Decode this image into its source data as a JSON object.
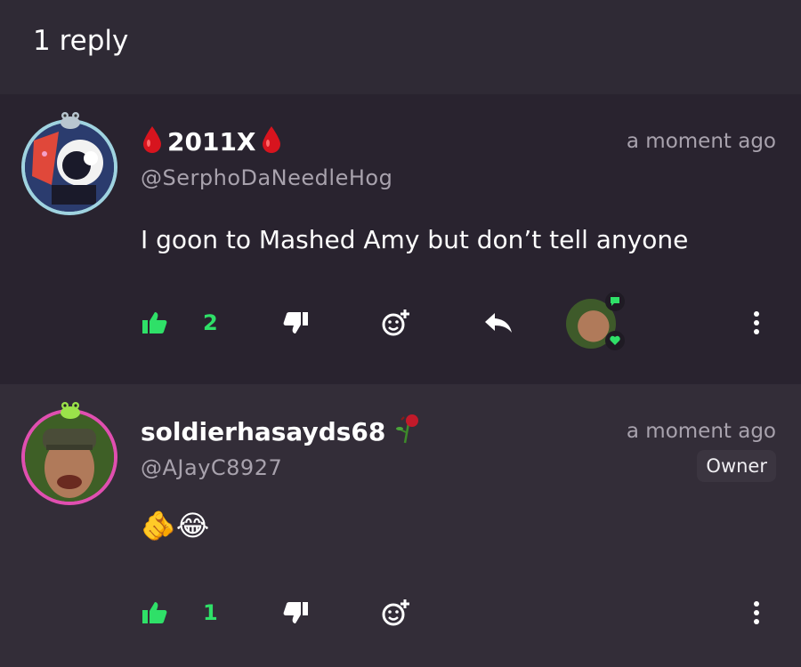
{
  "header": {
    "title": "1 reply"
  },
  "comments": [
    {
      "username": "2011X",
      "handle": "@SerphoDaNeedleHog",
      "time": "a moment ago",
      "body": "I goon to Mashed Amy but don’t tell anyone",
      "likes": "2",
      "decor_icon": "blood-drop-icon"
    },
    {
      "username": "soldierhasayds68",
      "handle": "@AJayC8927",
      "time": "a moment ago",
      "badge": "Owner",
      "body": "🫵😂",
      "likes": "1",
      "decor_icon": "wilted-rose-icon"
    }
  ],
  "colors": {
    "accent_green": "#2fe068",
    "background": "#29232f",
    "muted_text": "#a8a2ad"
  }
}
